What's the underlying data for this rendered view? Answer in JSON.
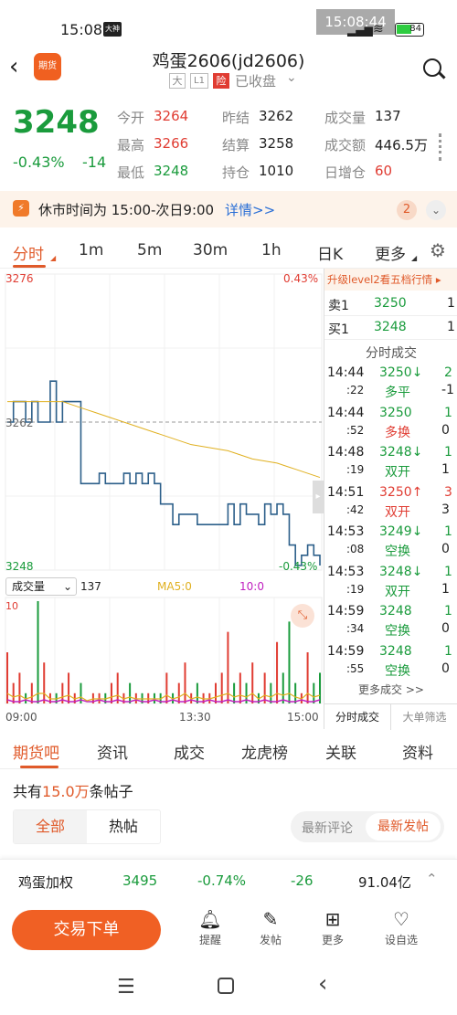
{
  "status": {
    "time": "15:08",
    "app_badge": "大神",
    "overlay_time": "15:08:44",
    "battery": "84"
  },
  "header": {
    "title": "鸡蛋2606(jd2606)",
    "tags": [
      "大",
      "L1",
      "险"
    ],
    "market_state": "已收盘",
    "logo_text": "期货"
  },
  "quote": {
    "price": "3248",
    "change_pct": "-0.43%",
    "change": "-14",
    "fields": [
      {
        "label": "今开",
        "value": "3264",
        "color": "red"
      },
      {
        "label": "昨结",
        "value": "3262",
        "color": "black"
      },
      {
        "label": "成交量",
        "value": "137",
        "color": "black"
      },
      {
        "label": "最高",
        "value": "3266",
        "color": "red"
      },
      {
        "label": "结算",
        "value": "3258",
        "color": "black"
      },
      {
        "label": "成交额",
        "value": "446.5万",
        "color": "black"
      },
      {
        "label": "最低",
        "value": "3248",
        "color": "green"
      },
      {
        "label": "持仓",
        "value": "1010",
        "color": "black"
      },
      {
        "label": "日增仓",
        "value": "60",
        "color": "red"
      }
    ]
  },
  "notice": {
    "text": "休市时间为 15:00-次日9:00",
    "link": "详情>>",
    "count": "2"
  },
  "chart_tabs": [
    "分时",
    "1m",
    "5m",
    "30m",
    "1h",
    "日K",
    "更多"
  ],
  "chart_data": {
    "type": "line",
    "y_top": "3276",
    "y_mid": "3262",
    "y_bottom": "3248",
    "pct_top": "0.43%",
    "pct_bottom": "-0.43%",
    "x_labels": [
      "09:00",
      "13:30",
      "15:00"
    ],
    "ylim": [
      3248,
      3276
    ],
    "price": [
      3262,
      3264,
      3264,
      3262,
      3264,
      3262,
      3262,
      3266,
      3262,
      3264,
      3264,
      3264,
      3256,
      3256,
      3256,
      3257,
      3256,
      3256,
      3256,
      3257,
      3256,
      3257,
      3256,
      3257,
      3256,
      3254,
      3254,
      3252,
      3253,
      3253,
      3253,
      3252,
      3252,
      3252,
      3252,
      3252,
      3254,
      3252,
      3254,
      3253,
      3253,
      3252,
      3254,
      3253,
      3254,
      3253,
      3250,
      3248,
      3249,
      3250,
      3249,
      3248
    ],
    "avg": [
      3264,
      3264,
      3264,
      3264,
      3264,
      3264,
      3264,
      3264,
      3264,
      3264,
      3263.8,
      3263.6,
      3263.4,
      3263.2,
      3263,
      3262.8,
      3262.6,
      3262.4,
      3262.2,
      3262,
      3261.8,
      3261.6,
      3261.4,
      3261.2,
      3261,
      3260.8,
      3260.6,
      3260.4,
      3260.2,
      3260,
      3259.8,
      3259.7,
      3259.6,
      3259.5,
      3259.4,
      3259.3,
      3259.2,
      3259,
      3258.8,
      3258.6,
      3258.4,
      3258.3,
      3258.2,
      3258.1,
      3258,
      3257.8,
      3257.6,
      3257.4,
      3257.2,
      3257,
      3256.8,
      3256.6
    ],
    "vol_label": "成交量",
    "vol_value": "137",
    "ma5_label": "MA5:0",
    "ma10_label": "10:0",
    "vol_max": "10",
    "volumes": [
      5,
      2,
      3,
      1,
      2,
      10,
      4,
      1,
      1,
      2,
      3,
      1,
      2,
      0,
      1,
      1,
      1,
      2,
      3,
      1,
      2,
      1,
      1,
      1,
      1,
      1,
      3,
      1,
      2,
      4,
      1,
      2,
      1,
      1,
      2,
      3,
      7,
      2,
      3,
      2,
      4,
      1,
      3,
      2,
      6,
      3,
      8,
      2,
      1,
      5,
      2,
      3
    ]
  },
  "orderbook": {
    "upgrade": "升级level2看五档行情 ▸",
    "ask": {
      "label": "卖1",
      "price": "3250",
      "qty": "1"
    },
    "bid": {
      "label": "买1",
      "price": "3248",
      "qty": "1"
    },
    "trades_title": "分时成交",
    "trades": [
      {
        "time": "14:44",
        "sec": ":22",
        "price": "3250↓",
        "pcolor": "green",
        "qty": "2",
        "type": "多平",
        "tcolor": "green",
        "chg": "-1"
      },
      {
        "time": "14:44",
        "sec": ":52",
        "price": "3250",
        "pcolor": "green",
        "qty": "1",
        "type": "多换",
        "tcolor": "red",
        "chg": "0"
      },
      {
        "time": "14:48",
        "sec": ":19",
        "price": "3248↓",
        "pcolor": "green",
        "qty": "1",
        "type": "双开",
        "tcolor": "green",
        "chg": "1"
      },
      {
        "time": "14:51",
        "sec": ":42",
        "price": "3250↑",
        "pcolor": "red",
        "qty": "3",
        "type": "双开",
        "tcolor": "red",
        "chg": "3"
      },
      {
        "time": "14:53",
        "sec": ":08",
        "price": "3249↓",
        "pcolor": "green",
        "qty": "1",
        "type": "空换",
        "tcolor": "green",
        "chg": "0"
      },
      {
        "time": "14:53",
        "sec": ":19",
        "price": "3248↓",
        "pcolor": "green",
        "qty": "1",
        "type": "双开",
        "tcolor": "green",
        "chg": "1"
      },
      {
        "time": "14:59",
        "sec": ":34",
        "price": "3248",
        "pcolor": "green",
        "qty": "1",
        "type": "空换",
        "tcolor": "green",
        "chg": "0"
      },
      {
        "time": "14:59",
        "sec": ":55",
        "price": "3248",
        "pcolor": "green",
        "qty": "1",
        "type": "空换",
        "tcolor": "green",
        "chg": "0"
      }
    ],
    "more": "更多成交 >>",
    "tab1": "分时成交",
    "tab2": "大单筛选"
  },
  "bottom_tabs": [
    "期货吧",
    "资讯",
    "成交",
    "龙虎榜",
    "关联",
    "资料"
  ],
  "forum": {
    "prefix": "共有",
    "count": "15.0万",
    "suffix": "条帖子",
    "filter_all": "全部",
    "filter_hot": "热帖",
    "sort_comment": "最新评论",
    "sort_post": "最新发帖"
  },
  "ticker": {
    "name": "鸡蛋加权",
    "price": "3495",
    "pct": "-0.74%",
    "chg": "-26",
    "amount": "91.04亿"
  },
  "actions": {
    "trade": "交易下单",
    "items": [
      "提醒",
      "发帖",
      "更多",
      "设自选"
    ]
  }
}
